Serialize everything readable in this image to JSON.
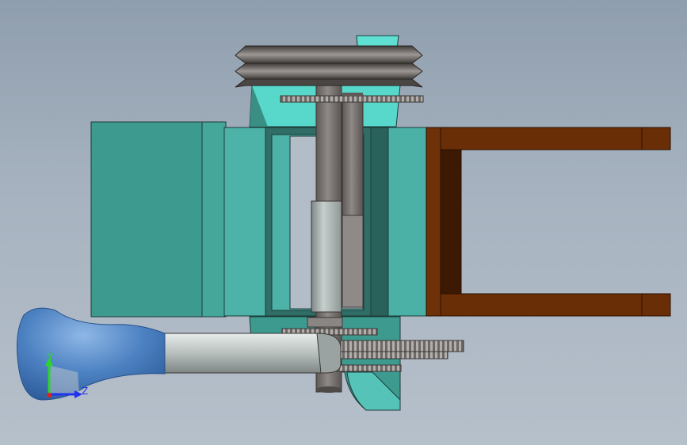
{
  "viewport": {
    "model_name": "",
    "view": "side"
  },
  "triad": {
    "axes": [
      {
        "label": "Y",
        "color": "#2bd62b"
      },
      {
        "label": "Z",
        "color": "#2233ee"
      }
    ],
    "x_color": "#e0201a"
  },
  "colors": {
    "background_top": "#8f9eae",
    "background_bottom": "#b6c0cb",
    "teal_dark": "#3a9a8e",
    "teal_mid": "#4bb0a6",
    "teal_light": "#60e0d2",
    "frame_brown": "#6a2e06",
    "frame_dark": "#3d1a02",
    "shaft_gray": "#7a7572",
    "handle_blue": "#4f84c4",
    "sleeve_gray": "#c4cbc9"
  }
}
